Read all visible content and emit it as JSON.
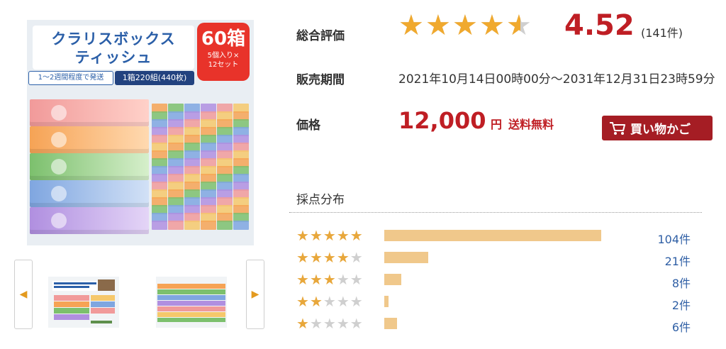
{
  "product_image": {
    "title": "クラリスボックス\nティッシュ",
    "badge_count": "60箱",
    "badge_sub": "5個入り×\n12セット",
    "note_left": "1〜2週間程度で発送",
    "note_right": "1箱220組(440枚)"
  },
  "thumbnails": {
    "prev_icon": "chevron-left-icon",
    "next_icon": "chevron-right-icon"
  },
  "rating": {
    "label": "総合評価",
    "value": "4.52",
    "count": "(141件)"
  },
  "period": {
    "label": "販売期間",
    "value": "2021年10月14日00時00分〜2031年12月31日23時59分"
  },
  "price": {
    "label": "価格",
    "amount": "12,000",
    "unit": "円",
    "shipping": "送料無料"
  },
  "cart_button": {
    "label": "買い物かご",
    "icon": "cart-icon"
  },
  "distribution": {
    "title": "採点分布",
    "rows": [
      {
        "stars": 5,
        "count": 104,
        "label": "104件"
      },
      {
        "stars": 4,
        "count": 21,
        "label": "21件"
      },
      {
        "stars": 3,
        "count": 8,
        "label": "8件"
      },
      {
        "stars": 2,
        "count": 2,
        "label": "2件"
      },
      {
        "stars": 1,
        "count": 6,
        "label": "6件"
      }
    ]
  },
  "colors": {
    "price_red": "#bf1e24",
    "star_gold": "#f0a92e",
    "bar": "#f0c88b",
    "count_blue": "#2f5fa5",
    "button": "#a51d24"
  }
}
